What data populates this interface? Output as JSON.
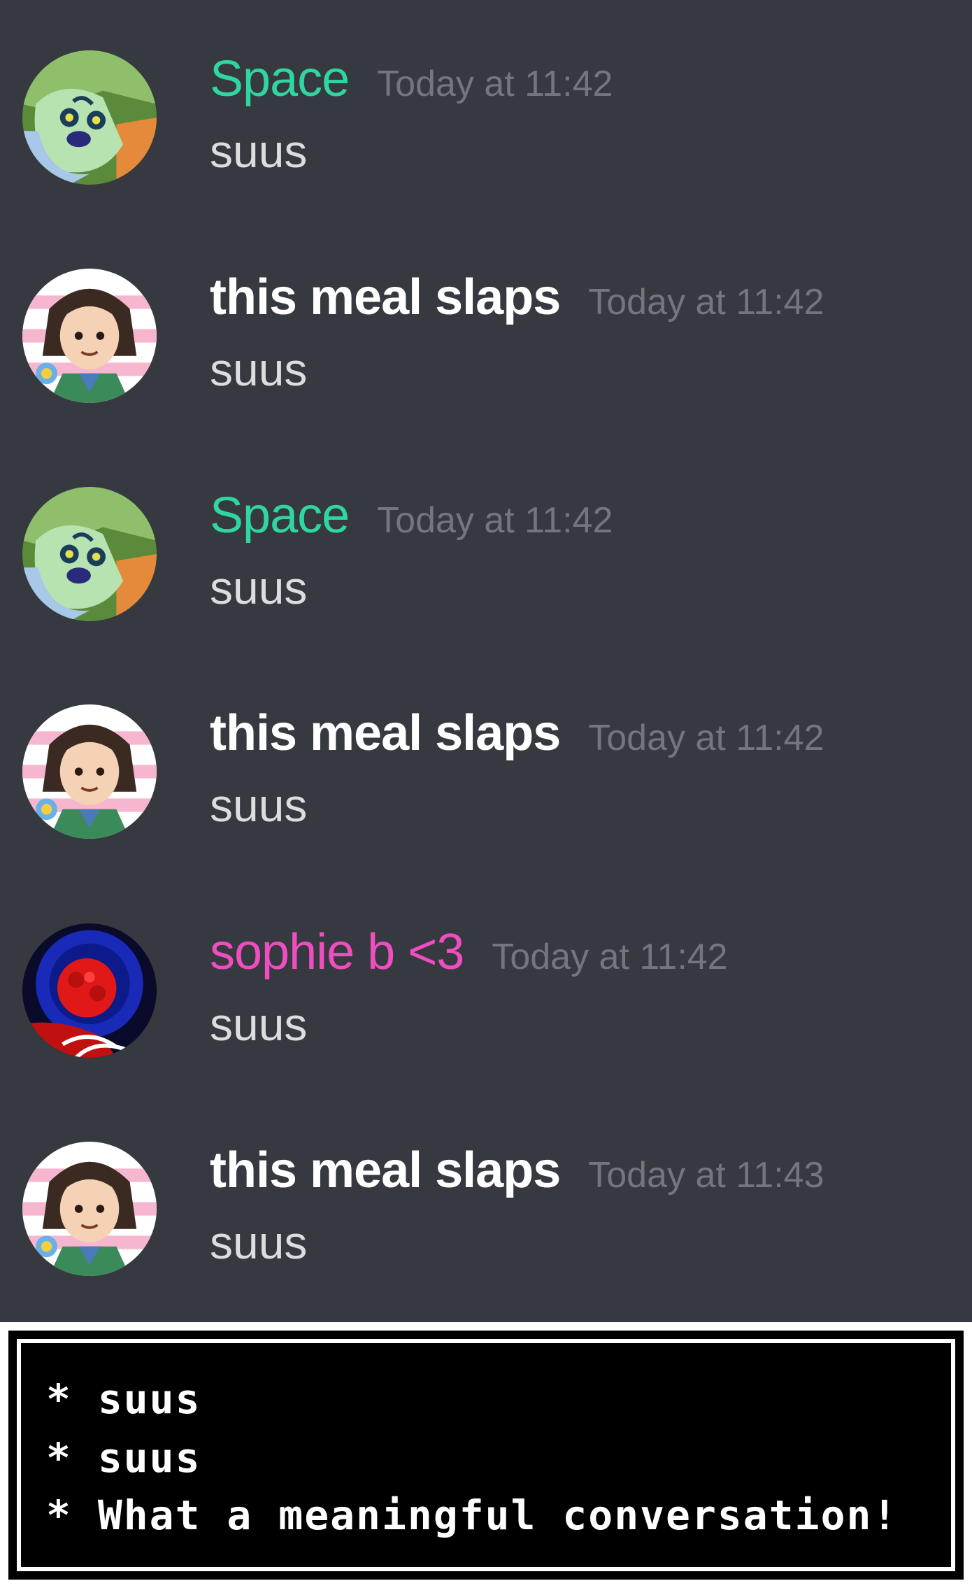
{
  "colors": {
    "background": "#36393f",
    "timestamp": "#72767d",
    "message_text": "#dcddde",
    "space_role": "#2fd6a4",
    "sophie_role": "#f04ec0",
    "default_name": "#ffffff"
  },
  "messages": [
    {
      "author": "Space",
      "author_color": "#2fd6a4",
      "timestamp": "Today at 11:42",
      "text": "suus",
      "avatar": "green-creature-avatar"
    },
    {
      "author": "this meal slaps",
      "author_color": "#ffffff",
      "timestamp": "Today at 11:42",
      "text": "suus",
      "avatar": "anime-girl-avatar"
    },
    {
      "author": "Space",
      "author_color": "#2fd6a4",
      "timestamp": "Today at 11:42",
      "text": "suus",
      "avatar": "green-creature-avatar"
    },
    {
      "author": "this meal slaps",
      "author_color": "#ffffff",
      "timestamp": "Today at 11:42",
      "text": "suus",
      "avatar": "anime-girl-avatar"
    },
    {
      "author": "sophie b <3",
      "author_color": "#f04ec0",
      "timestamp": "Today at 11:42",
      "text": "suus",
      "avatar": "red-flower-blue-avatar"
    },
    {
      "author": "this meal slaps",
      "author_color": "#ffffff",
      "timestamp": "Today at 11:43",
      "text": "suus",
      "avatar": "anime-girl-avatar"
    }
  ],
  "game_dialog": {
    "lines": [
      "* suus",
      "* suus",
      "* What a meaningful conversation!"
    ]
  }
}
